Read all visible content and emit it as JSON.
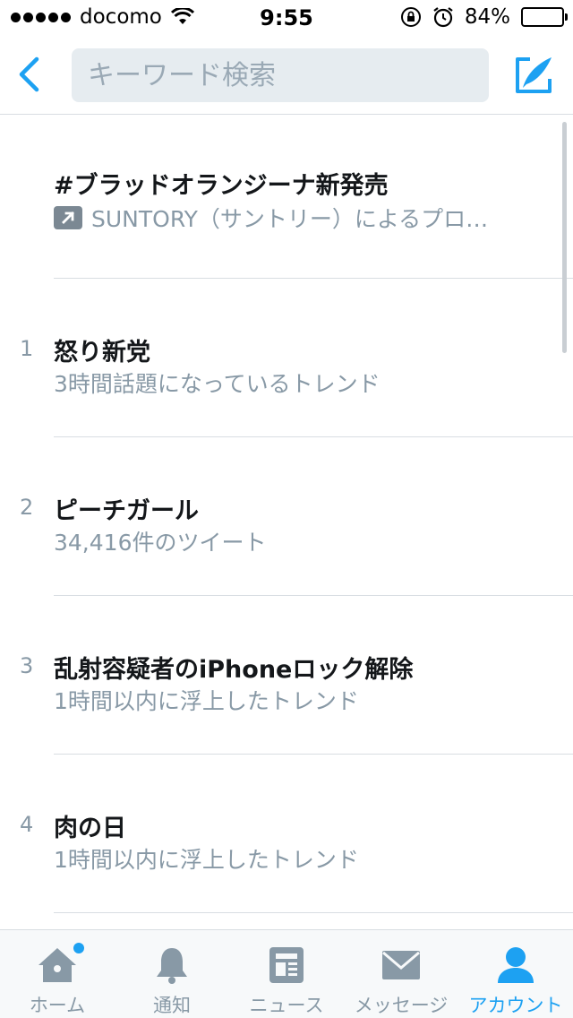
{
  "status_bar": {
    "carrier": "docomo",
    "time": "9:55",
    "battery": "84%",
    "battery_level": 0.84
  },
  "header": {
    "search_placeholder": "キーワード検索",
    "back_icon": "chevron-left-icon",
    "compose_icon": "compose-icon"
  },
  "trends": [
    {
      "rank": "",
      "title": "#ブラッドオランジーナ新発売",
      "subtitle": "SUNTORY（サントリー）によるプロ…",
      "promoted": true
    },
    {
      "rank": "1",
      "title": "怒り新党",
      "subtitle": "3時間話題になっているトレンド",
      "promoted": false
    },
    {
      "rank": "2",
      "title": "ピーチガール",
      "subtitle": "34,416件のツイート",
      "promoted": false
    },
    {
      "rank": "3",
      "title": "乱射容疑者のiPhoneロック解除",
      "subtitle": "1時間以内に浮上したトレンド",
      "promoted": false
    },
    {
      "rank": "4",
      "title": "肉の日",
      "subtitle": "1時間以内に浮上したトレンド",
      "promoted": false
    }
  ],
  "tabbar": {
    "tabs": [
      {
        "label": "ホーム",
        "icon": "home-icon"
      },
      {
        "label": "通知",
        "icon": "bell-icon"
      },
      {
        "label": "ニュース",
        "icon": "news-icon"
      },
      {
        "label": "メッセージ",
        "icon": "envelope-icon"
      },
      {
        "label": "アカウント",
        "icon": "person-icon"
      }
    ],
    "active_index": 4
  },
  "colors": {
    "accent": "#1da1f2",
    "muted": "#8899a6",
    "text": "#14171a"
  }
}
